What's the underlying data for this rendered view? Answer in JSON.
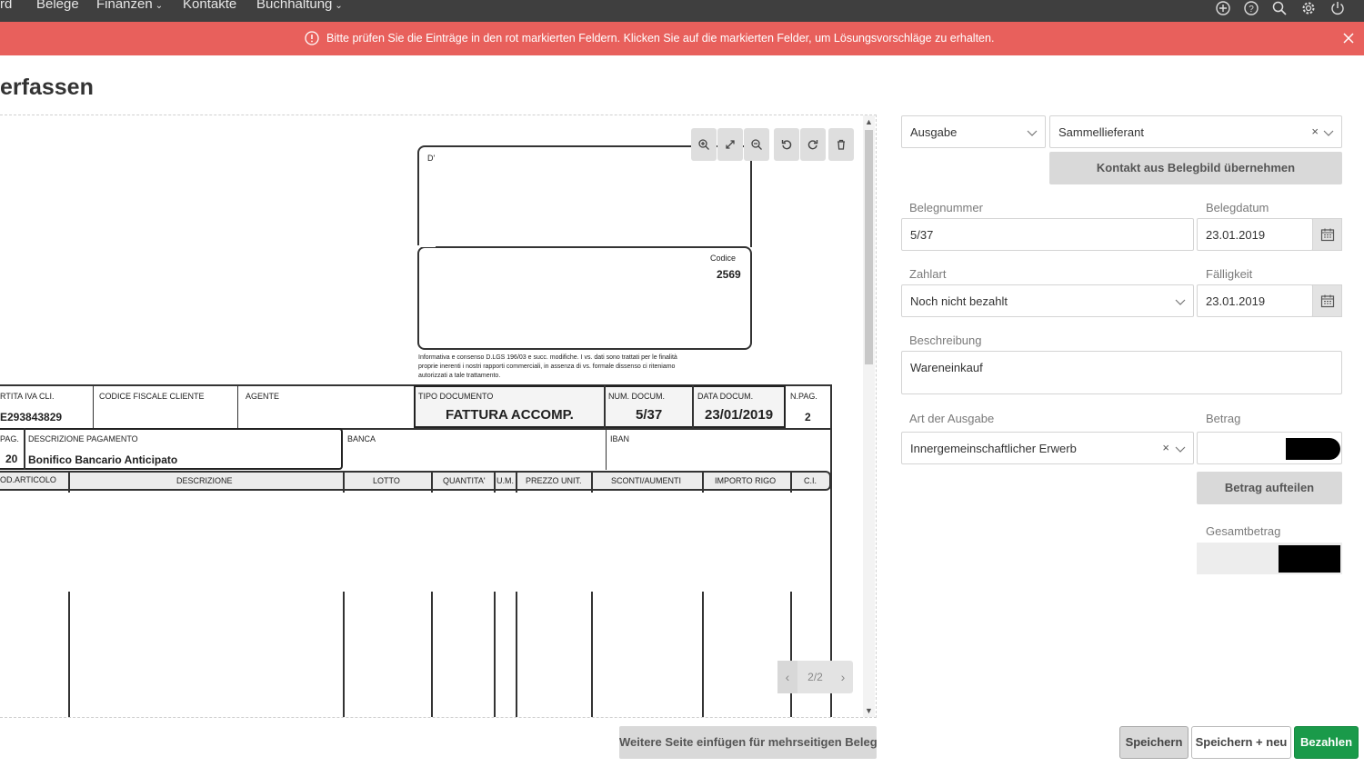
{
  "nav": {
    "items": [
      "rd",
      "Belege",
      "Finanzen",
      "Kontakte",
      "Buchhaltung"
    ],
    "icons": [
      "plus-circle-icon",
      "help-icon",
      "search-icon",
      "gear-icon",
      "power-icon"
    ]
  },
  "alert": {
    "text": "Bitte prüfen Sie die Einträge in den rot markierten Feldern. Klicken Sie auf die markierten Felder, um Lösungsvorschläge zu erhalten.",
    "color": "#e8605c"
  },
  "page": {
    "title": "erfassen"
  },
  "viewer": {
    "pager_label": "2/2",
    "add_page_button": "Weitere Seite einfügen für mehrseitigen Beleg"
  },
  "invoice": {
    "d_label": "D'",
    "codice_label": "Codice",
    "codice_value": "2569",
    "privacy_line1": "Informativa e consenso D.LGS 196/03 e succ. modifiche. I vs. dati sono trattati per le finalità",
    "privacy_line2": "proprie inerenti i nostri rapporti commerciali, in assenza di vs. formale dissenso ci riteniamo",
    "privacy_line3": "autorizzati a tale trattamento.",
    "partita_iva_label": "RTITA IVA CLI.",
    "partita_iva_value": "E293843829",
    "codice_fiscale_label": "CODICE FISCALE CLIENTE",
    "agente_label": "AGENTE",
    "tipo_doc_label": "TIPO DOCUMENTO",
    "tipo_doc_value": "FATTURA ACCOMP.",
    "num_doc_label": "NUM. DOCUM.",
    "num_doc_value": "5/37",
    "data_doc_label": "DATA DOCUM.",
    "data_doc_value": "23/01/2019",
    "npag_label": "N.PAG.",
    "npag_value": "2",
    "pag_label": "PAG.",
    "pag_value": "20",
    "desc_pag_label": "DESCRIZIONE PAGAMENTO",
    "desc_pag_value": "Bonifico Bancario Anticipato",
    "banca_label": "BANCA",
    "iban_label": "IBAN",
    "columns": [
      "OD.ARTICOLO",
      "DESCRIZIONE",
      "LOTTO",
      "QUANTITA'",
      "U.M.",
      "PREZZO UNIT.",
      "SCONTI/AUMENTI",
      "IMPORTO RIGO",
      "C.I."
    ]
  },
  "form": {
    "type_select": "Ausgabe",
    "contact_select": "Sammellieferant",
    "contact_button": "Kontakt aus Belegbild übernehmen",
    "belegnummer_label": "Belegnummer",
    "belegnummer_value": "5/37",
    "belegdatum_label": "Belegdatum",
    "belegdatum_value": "23.01.2019",
    "zahlart_label": "Zahlart",
    "zahlart_value": "Noch nicht bezahlt",
    "faelligkeit_label": "Fälligkeit",
    "faelligkeit_value": "23.01.2019",
    "beschreibung_label": "Beschreibung",
    "beschreibung_value": "Wareneinkauf",
    "art_label": "Art der Ausgabe",
    "art_value": "Innergemeinschaftlicher Erwerb",
    "betrag_label": "Betrag",
    "split_button": "Betrag aufteilen",
    "gesamt_label": "Gesamtbetrag"
  },
  "footer": {
    "save": "Speichern",
    "save_new": "Speichern + neu",
    "pay": "Bezahlen",
    "pay_color": "#1a9a4a"
  }
}
